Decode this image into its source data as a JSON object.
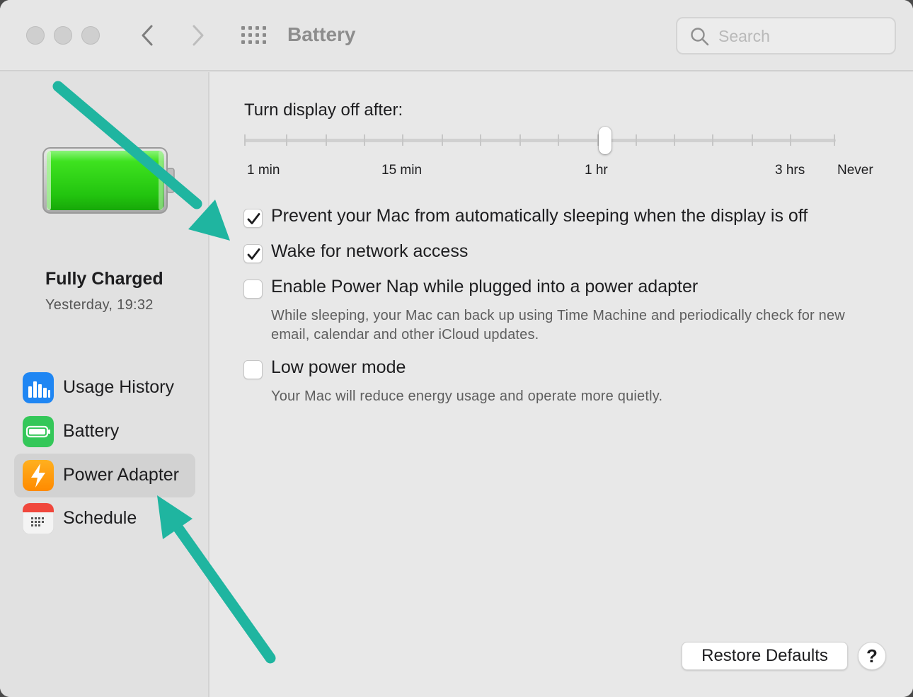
{
  "window": {
    "title": "Battery",
    "search": {
      "placeholder": "Search",
      "value": ""
    }
  },
  "sidebar": {
    "status_title": "Fully Charged",
    "status_time": "Yesterday, 19:32",
    "battery_level": 1.0,
    "items": [
      {
        "label": "Usage History",
        "icon": "bar-chart-icon",
        "selected": false
      },
      {
        "label": "Battery",
        "icon": "battery-icon",
        "selected": false
      },
      {
        "label": "Power Adapter",
        "icon": "lightning-bolt-icon",
        "selected": true
      },
      {
        "label": "Schedule",
        "icon": "calendar-icon",
        "selected": false
      }
    ]
  },
  "main": {
    "slider": {
      "label": "Turn display off after:",
      "value": "1 hr",
      "tick_labels": [
        "1 min",
        "15 min",
        "1 hr",
        "3 hrs",
        "Never"
      ]
    },
    "options": [
      {
        "label": "Prevent your Mac from automatically sleeping when the display is off",
        "checked": true,
        "description": ""
      },
      {
        "label": "Wake for network access",
        "checked": true,
        "description": ""
      },
      {
        "label": "Enable Power Nap while plugged into a power adapter",
        "checked": false,
        "description": "While sleeping, your Mac can back up using Time Machine and periodically check for new email, calendar and other iCloud updates."
      },
      {
        "label": "Low power mode",
        "checked": false,
        "description": "Your Mac will reduce energy usage and operate more quietly."
      }
    ],
    "restore_label": "Restore Defaults",
    "help_label": "?"
  },
  "colors": {
    "annotation_arrow": "#1fb5a0",
    "battery_green": "#2fd11a",
    "selected_item": "#d2d2d2"
  }
}
